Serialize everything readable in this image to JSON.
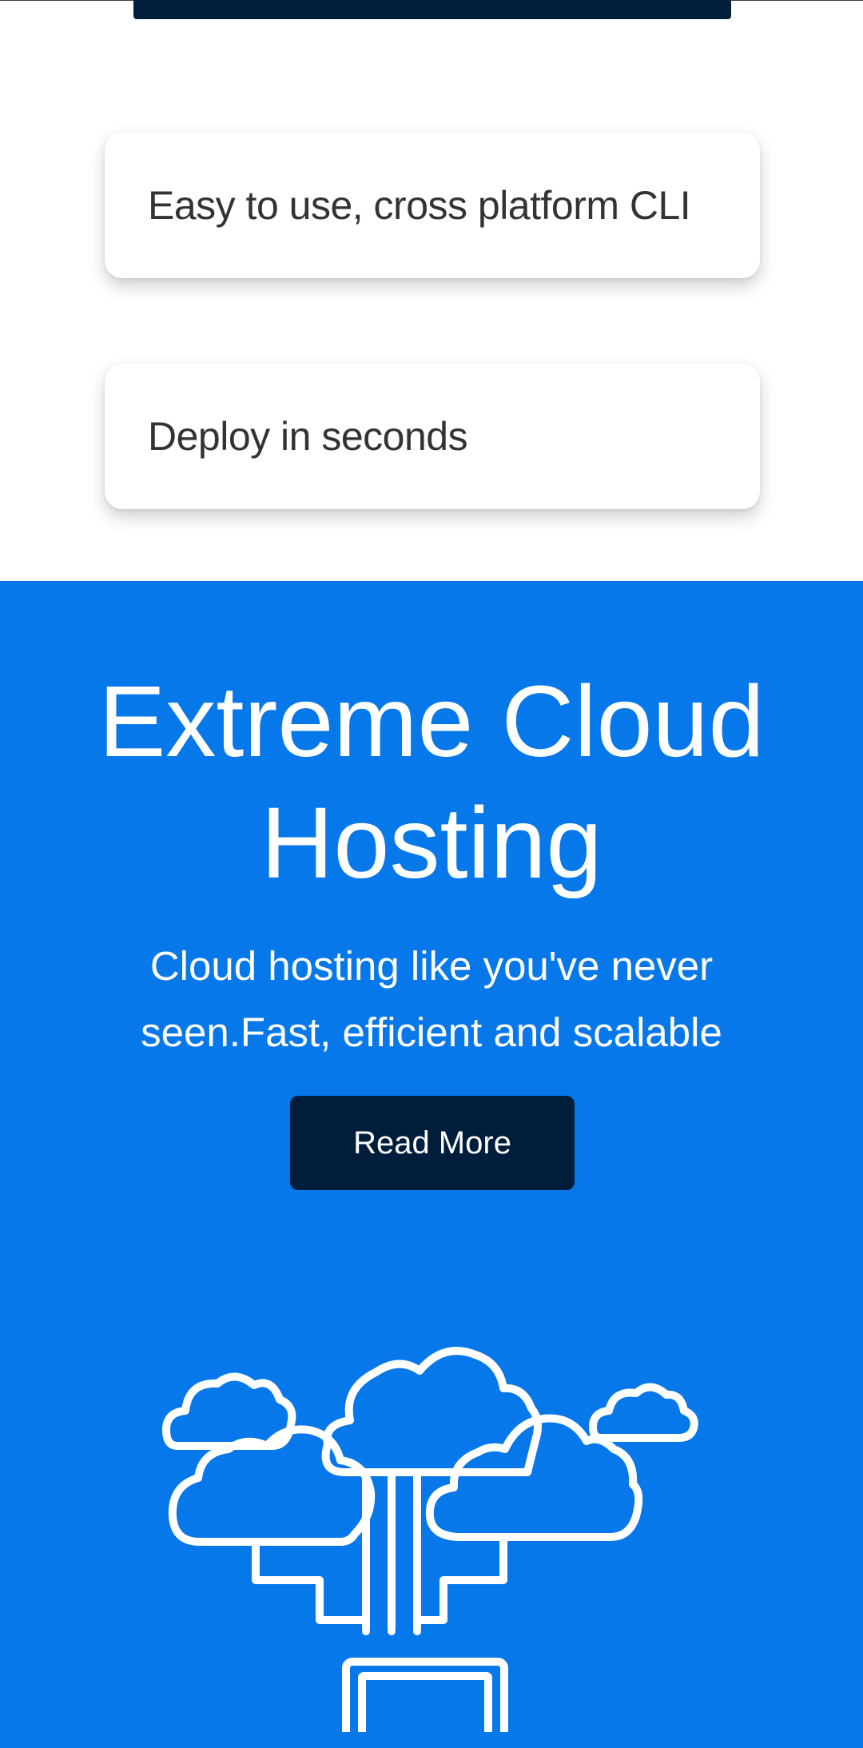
{
  "features": [
    {
      "label": "Easy to use, cross platform CLI"
    },
    {
      "label": "Deploy in seconds"
    }
  ],
  "hero": {
    "title": "Extreme Cloud Hosting",
    "subtitle": "Cloud hosting like you've never seen.Fast, efficient and scalable",
    "button_label": "Read More",
    "illustration_icon": "cloud-network-laptop-icon"
  },
  "colors": {
    "hero_background": "#0778e9",
    "dark_navy": "#001e3c",
    "card_text": "#333333"
  }
}
